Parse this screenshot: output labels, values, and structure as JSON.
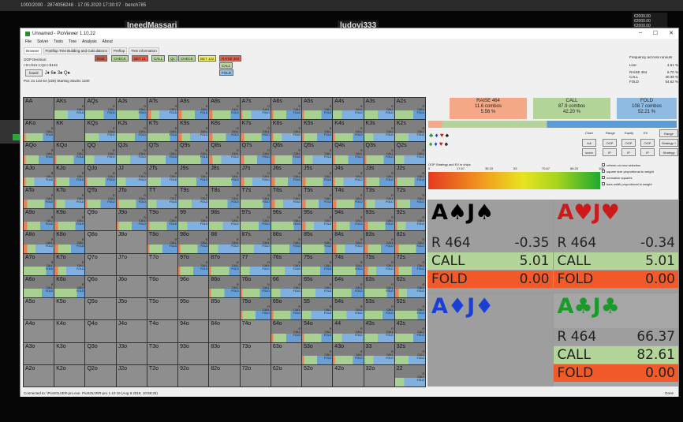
{
  "topbar": "1000/2000 · 2874056248 · 17.05.2020 17:30:07 · bench785",
  "bg": {
    "player1": "IneedMassari",
    "player2": "ludovi333",
    "right_lines": [
      "€2000.00",
      "€2000.00",
      "€2000.00"
    ]
  },
  "window": {
    "title": "Unnamed - PioViewer 1.10.22",
    "controls": [
      "–",
      "☐",
      "✕"
    ]
  },
  "menu": [
    "File",
    "Solver",
    "Tools",
    "Tree",
    "Analysis",
    "About"
  ],
  "tabs": [
    "Browser",
    "Postflop Tree Building and Calculations",
    "Preflop",
    "Tree information"
  ],
  "left": {
    "decision": "OOP Decision:",
    "line": "r:0:c:b21:c:Qc:c:b143",
    "board_btn": "board",
    "board_cards": "J♦ 6♠ 3♠ Q♠",
    "pot": "Pot: 21 143 64 (228) Starting Stacks 1100"
  },
  "actions": [
    {
      "label": "Root",
      "color": "#c55a4a"
    },
    {
      "label": "CHECK",
      "color": "#b7d79c"
    },
    {
      "label": "BET 21",
      "color": "#e06050"
    },
    {
      "label": "CALL",
      "color": "#b7d79c"
    },
    {
      "label": "Qc",
      "color": "#b7d79c"
    },
    {
      "label": "CHECK",
      "color": "#b7d79c"
    },
    {
      "label": "BET 122",
      "color": "#f7f06a"
    },
    {
      "label": "RAISE 464",
      "color": "#e06050"
    },
    {
      "label": "CALL",
      "color": "#b7d79c"
    },
    {
      "label": "FOLD",
      "color": "#8fc0e8"
    }
  ],
  "freq": {
    "title": "Frequency accross runouts",
    "rows": [
      [
        "Line:",
        "4.51 %"
      ],
      [
        "RAISE 464",
        "6.70 %"
      ],
      [
        "CALL",
        "40.39 %"
      ],
      [
        "FOLD",
        "54.62 %"
      ]
    ]
  },
  "ranks": [
    "A",
    "K",
    "Q",
    "J",
    "T",
    "9",
    "8",
    "7",
    "6",
    "5",
    "4",
    "3",
    "2"
  ],
  "summary": [
    {
      "title": "RAISE 464",
      "combos": "11.6 combos",
      "pct": "5.56 %",
      "color": "#f4a886"
    },
    {
      "title": "CALL",
      "combos": "87.9 combos",
      "pct": "42.20 %",
      "color": "#b4d59a"
    },
    {
      "title": "FOLD",
      "combos": "108.7 combos",
      "pct": "52.21 %",
      "color": "#8fbbe3"
    }
  ],
  "freqbar": {
    "raise": 0.0556,
    "call": 0.422,
    "fold": 0.5221
  },
  "suits": {
    "row1": [
      "♣",
      "♦",
      "♥",
      "♠"
    ],
    "row2": [
      "♠",
      "♦",
      "♥",
      "♠"
    ]
  },
  "controls": {
    "headers": [
      "Chart",
      "Range",
      "Equity",
      "EV"
    ],
    "row1": [
      "full",
      "OOP",
      "OOP",
      "OOP"
    ],
    "row2": [
      "score",
      "IP",
      "IP",
      "IP"
    ],
    "side": [
      "Range Explorer",
      "Strategy + EV",
      "Strategy"
    ]
  },
  "ev": {
    "title": "OOP Strategy and EV in chips",
    "ticks": [
      "0",
      "17.67",
      "35.33",
      "53",
      "70.67",
      "88.33",
      "106"
    ]
  },
  "checks": [
    "refresh on new selection",
    "square size proportional to weight",
    "normalize squares",
    "bars width proportional to weight"
  ],
  "combos": [
    {
      "name": "A♠J♠",
      "color": "#000000",
      "rows": [
        [
          "R 464",
          "-0.35"
        ],
        [
          "CALL",
          "5.01"
        ],
        [
          "FOLD",
          "0.00"
        ]
      ]
    },
    {
      "name": "A♥J♥",
      "color": "#cc1a1a",
      "rows": [
        [
          "R 464",
          "-0.34"
        ],
        [
          "CALL",
          "5.01"
        ],
        [
          "FOLD",
          "0.00"
        ]
      ]
    },
    {
      "name": "A♦J♦",
      "color": "#1a3fd6",
      "rows": []
    },
    {
      "name": "A♣J♣",
      "color": "#1a9a2a",
      "rows": [
        [
          "R 464",
          "66.37"
        ],
        [
          "CALL",
          "82.61"
        ],
        [
          "FOLD",
          "0.00"
        ]
      ]
    }
  ],
  "status": {
    "left": "Connected to: \\PioSOLVER-pro.exe. PioSOLVER-pro 1.10.19 (Aug  8 2018, 10:58:25)",
    "right": "Done"
  }
}
